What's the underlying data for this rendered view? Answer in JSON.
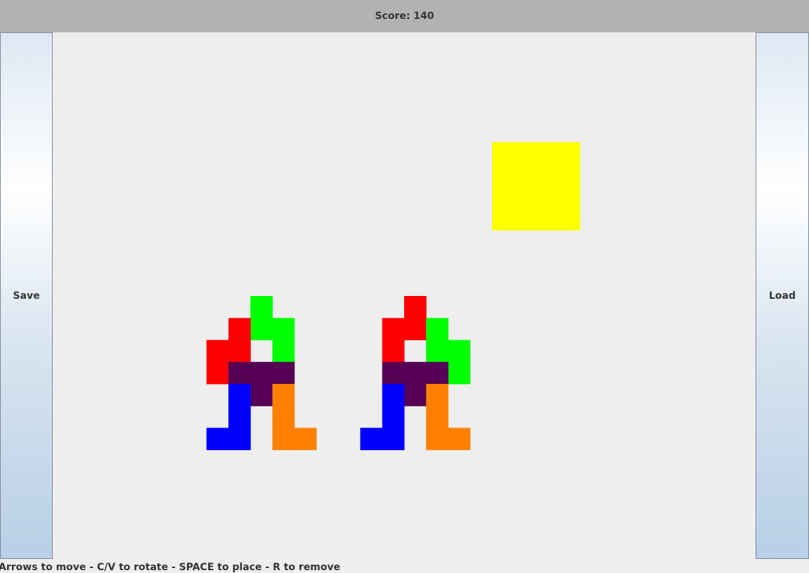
{
  "score_bar": {
    "text": "Score: 140"
  },
  "save_button": {
    "label": "Save"
  },
  "load_button": {
    "label": "Load"
  },
  "instructions": {
    "text": "Arrows to move - C/V to rotate - SPACE to place - R to remove"
  },
  "colors": {
    "red": "#ff0000",
    "green": "#00ff00",
    "purple": "#550055",
    "blue": "#0000ff",
    "orange": "#ff8000",
    "yellow": "#ffff00"
  },
  "board": {
    "cell_units": "grid cells",
    "active_piece": {
      "name": "active-yellow-piece",
      "color": "yellow",
      "cells": [
        [
          0,
          0
        ],
        [
          1,
          0
        ],
        [
          2,
          0
        ],
        [
          3,
          0
        ],
        [
          0,
          1
        ],
        [
          1,
          1
        ],
        [
          2,
          1
        ],
        [
          3,
          1
        ],
        [
          0,
          2
        ],
        [
          1,
          2
        ],
        [
          2,
          2
        ],
        [
          3,
          2
        ],
        [
          0,
          3
        ],
        [
          1,
          3
        ],
        [
          2,
          3
        ],
        [
          3,
          3
        ]
      ],
      "origin": [
        20,
        5
      ]
    },
    "placed_pieces": [
      {
        "name": "placed-green-piece",
        "color": "green",
        "cells": [
          [
            9,
            12
          ],
          [
            9,
            13
          ],
          [
            10,
            13
          ],
          [
            10,
            14
          ]
        ]
      },
      {
        "name": "placed-red-piece",
        "color": "red",
        "cells": [
          [
            8,
            13
          ],
          [
            7,
            14
          ],
          [
            8,
            14
          ],
          [
            7,
            15
          ]
        ]
      },
      {
        "name": "placed-purple-piece",
        "color": "purple",
        "cells": [
          [
            8,
            15
          ],
          [
            9,
            15
          ],
          [
            10,
            15
          ],
          [
            9,
            16
          ]
        ]
      },
      {
        "name": "placed-blue-piece",
        "color": "blue",
        "cells": [
          [
            8,
            16
          ],
          [
            8,
            17
          ],
          [
            7,
            18
          ],
          [
            8,
            18
          ]
        ]
      },
      {
        "name": "placed-orange-piece",
        "color": "orange",
        "cells": [
          [
            10,
            16
          ],
          [
            10,
            17
          ],
          [
            10,
            18
          ],
          [
            11,
            18
          ]
        ]
      },
      {
        "name": "placed-red-piece",
        "color": "red",
        "cells": [
          [
            16,
            12
          ],
          [
            15,
            13
          ],
          [
            16,
            13
          ],
          [
            15,
            14
          ]
        ]
      },
      {
        "name": "placed-green-piece",
        "color": "green",
        "cells": [
          [
            17,
            13
          ],
          [
            17,
            14
          ],
          [
            18,
            14
          ],
          [
            18,
            15
          ]
        ]
      },
      {
        "name": "placed-purple-piece",
        "color": "purple",
        "cells": [
          [
            15,
            15
          ],
          [
            16,
            15
          ],
          [
            17,
            15
          ],
          [
            16,
            16
          ]
        ]
      },
      {
        "name": "placed-blue-piece",
        "color": "blue",
        "cells": [
          [
            15,
            16
          ],
          [
            15,
            17
          ],
          [
            14,
            18
          ],
          [
            15,
            18
          ]
        ]
      },
      {
        "name": "placed-orange-piece",
        "color": "orange",
        "cells": [
          [
            17,
            16
          ],
          [
            17,
            17
          ],
          [
            17,
            18
          ],
          [
            18,
            18
          ]
        ]
      }
    ]
  }
}
